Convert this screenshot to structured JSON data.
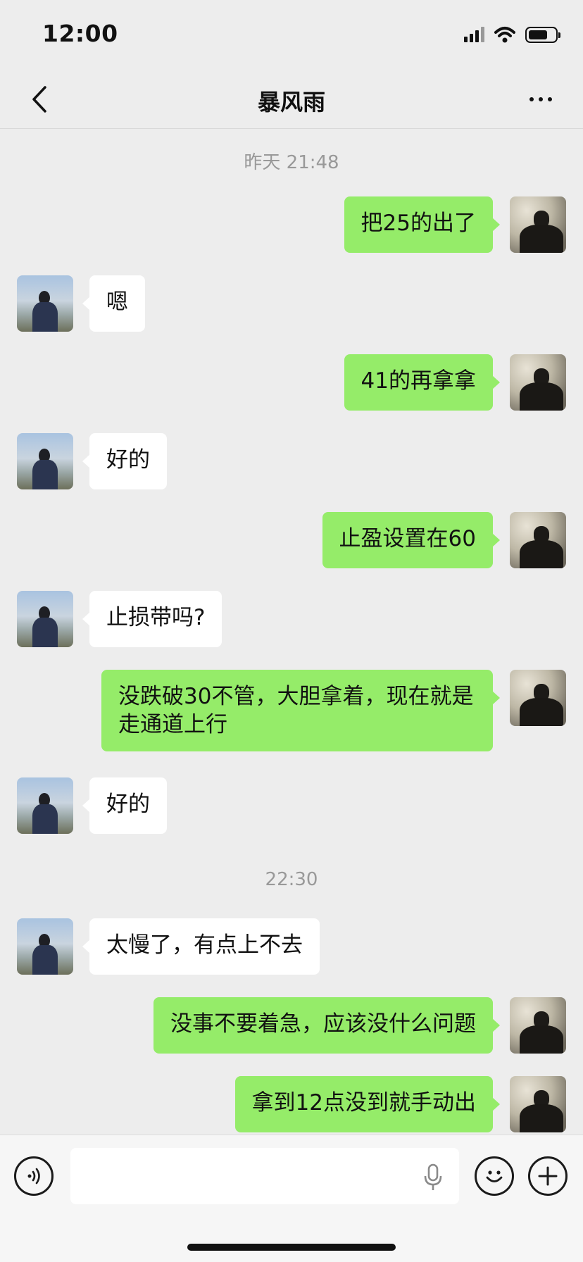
{
  "status_bar": {
    "time": "12:00"
  },
  "nav": {
    "title": "暴风雨"
  },
  "chat": {
    "timestamps": [
      "昨天 21:48",
      "22:30"
    ],
    "messages": [
      {
        "side": "right",
        "text": "把25的出了"
      },
      {
        "side": "left",
        "text": "嗯"
      },
      {
        "side": "right",
        "text": "41的再拿拿"
      },
      {
        "side": "left",
        "text": "好的"
      },
      {
        "side": "right",
        "text": "止盈设置在60"
      },
      {
        "side": "left",
        "text": "止损带吗?"
      },
      {
        "side": "right",
        "text": "没跌破30不管，大胆拿着，现在就是走通道上行"
      },
      {
        "side": "left",
        "text": "好的"
      },
      {
        "side": "left",
        "text": "太慢了，有点上不去"
      },
      {
        "side": "right",
        "text": "没事不要着急，应该没什么问题"
      },
      {
        "side": "right",
        "text": "拿到12点没到就手动出"
      }
    ]
  },
  "input": {
    "value": "",
    "placeholder": ""
  },
  "colors": {
    "sent_bubble": "#95ec69",
    "received_bubble": "#ffffff",
    "background": "#ededed"
  },
  "icons": [
    "back-icon",
    "more-icon",
    "voice-icon",
    "mic-icon",
    "emoji-icon",
    "plus-icon",
    "signal-icon",
    "wifi-icon",
    "battery-icon"
  ]
}
